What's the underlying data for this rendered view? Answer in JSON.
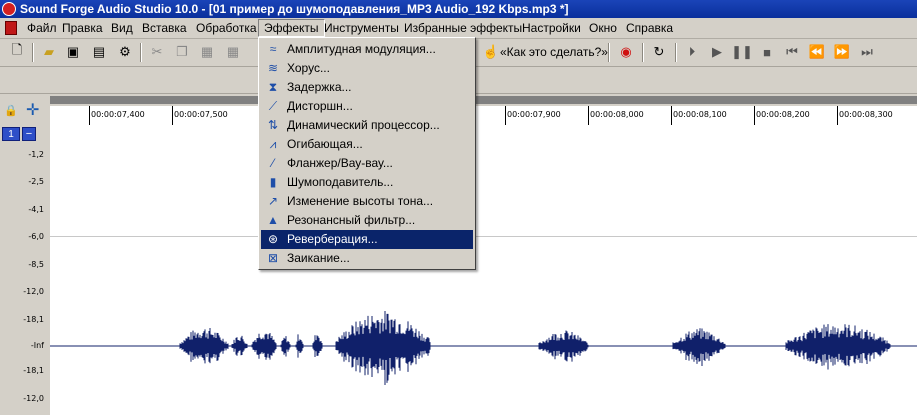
{
  "window": {
    "title": "Sound Forge Audio Studio 10.0 - [01 пример до шумоподавления_MP3 Audio_192 Kbps.mp3 *]"
  },
  "menubar": {
    "items": [
      "Файл",
      "Правка",
      "Вид",
      "Вставка",
      "Обработка",
      "Эффекты",
      "Инструменты",
      "Избранные эффекты",
      "Настройки",
      "Окно",
      "Справка"
    ],
    "active": "Эффекты"
  },
  "toolbar": {
    "help_label": "«Как это сделать?»"
  },
  "effects_menu": {
    "items": [
      {
        "label": "Амплитудная модуляция...",
        "icon": "amplitude-modulation-icon",
        "glyph": "≈"
      },
      {
        "label": "Хорус...",
        "icon": "chorus-icon",
        "glyph": "≋"
      },
      {
        "label": "Задержка...",
        "icon": "delay-icon",
        "glyph": "⧗"
      },
      {
        "label": "Дисторшн...",
        "icon": "distortion-icon",
        "glyph": "⟋"
      },
      {
        "label": "Динамический процессор...",
        "icon": "dynamics-icon",
        "glyph": "⇅"
      },
      {
        "label": "Огибающая...",
        "icon": "envelope-icon",
        "glyph": "⩘"
      },
      {
        "label": "Фланжер/Вау-вау...",
        "icon": "flanger-icon",
        "glyph": "⁄"
      },
      {
        "label": "Шумоподавитель...",
        "icon": "noise-gate-icon",
        "glyph": "▮"
      },
      {
        "label": "Изменение высоты тона...",
        "icon": "pitch-shift-icon",
        "glyph": "↗"
      },
      {
        "label": "Резонансный фильтр...",
        "icon": "resonant-filter-icon",
        "glyph": "▲"
      },
      {
        "label": "Реверберация...",
        "icon": "reverb-icon",
        "glyph": "⊛"
      },
      {
        "label": "Заикание...",
        "icon": "stutter-icon",
        "glyph": "⊠"
      }
    ],
    "selected_index": 10
  },
  "ruler": {
    "labels": [
      "00:00:07,400",
      "00:00:07,500",
      "00:00:07,900",
      "00:00:08,000",
      "00:00:08,100",
      "00:00:08,200",
      "00:00:08,300"
    ]
  },
  "track": {
    "channel_number": "1",
    "collapse_label": "−",
    "db_labels": [
      "-1,2",
      "-2,5",
      "-4,1",
      "-6,0",
      "-8,5",
      "-12,0",
      "-18,1",
      "-Inf",
      "-18,1",
      "-12,0"
    ]
  },
  "waveform": {
    "color": "#10206a",
    "segments": [
      [
        130,
        178,
        0.55
      ],
      [
        182,
        197,
        0.35
      ],
      [
        202,
        226,
        0.5
      ],
      [
        231,
        240,
        0.3
      ],
      [
        246,
        253,
        0.4
      ],
      [
        263,
        272,
        0.45
      ],
      [
        286,
        380,
        1.0
      ],
      [
        489,
        538,
        0.45
      ],
      [
        623,
        675,
        0.5
      ],
      [
        736,
        840,
        0.65
      ]
    ]
  }
}
